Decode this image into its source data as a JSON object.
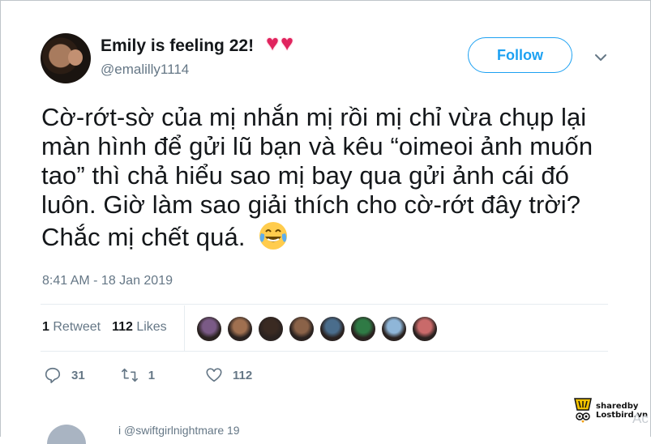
{
  "author": {
    "display_name": "Emily is feeling 22!",
    "display_name_emoji": "💖💖",
    "handle": "@emalilly1114"
  },
  "follow_label": "Follow",
  "tweet": {
    "text": "Cờ-rớt-sờ của mị nhắn mị rồi mị chỉ vừa chụp lại màn hình để gửi lũ bạn và kêu “oimeoi ảnh muốn tao” thì chả hiểu sao mị bay qua gửi ảnh cái đó luôn. Giờ làm sao giải thích cho cờ-rớt đây trời? Chắc mị chết quá.",
    "emoji": "tears-of-joy-emoji",
    "timestamp": "8:41 AM - 18 Jan 2019"
  },
  "stats": {
    "retweets_count": "1",
    "retweets_label": "Retweet",
    "likes_count": "112",
    "likes_label": "Likes"
  },
  "liker_colors": [
    "#7a5a86",
    "#a07050",
    "#3a2a22",
    "#8a6248",
    "#4a6d8c",
    "#2f7a45",
    "#8fb6d8",
    "#c96a6a"
  ],
  "actions": {
    "reply_count": "31",
    "retweet_count": "1",
    "like_count": "112"
  },
  "next_tweet_text": "i  @swiftgirlnightmare  19",
  "watermark": {
    "line1": "sharedby",
    "line2": "Lostbird.vn"
  },
  "activation_text": "Ac",
  "colors": {
    "accent": "#1da1f2",
    "text": "#14171a",
    "secondary": "#657786",
    "heart": "#e0245e"
  }
}
